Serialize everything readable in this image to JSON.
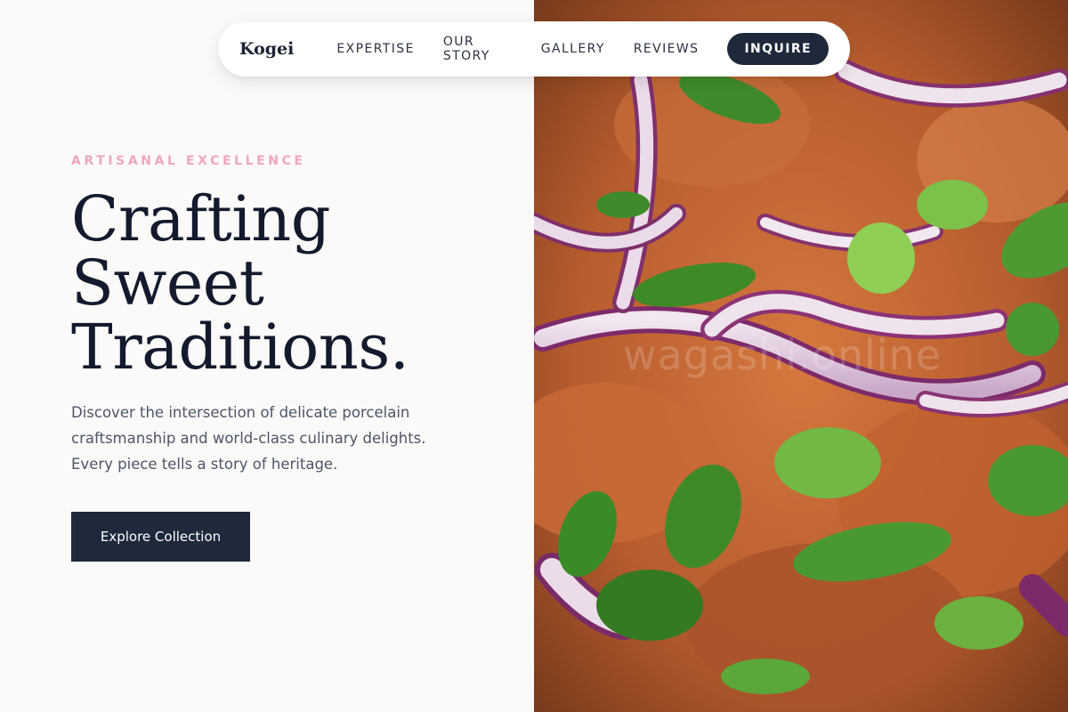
{
  "nav": {
    "brand": "Kogei",
    "links": [
      "EXPERTISE",
      "OUR STORY",
      "GALLERY",
      "REVIEWS"
    ],
    "cta_label": "INQUIRE"
  },
  "hero": {
    "eyebrow": "ARTISANAL EXCELLENCE",
    "headline": [
      "Crafting",
      "Sweet",
      "Traditions."
    ],
    "description": "Discover the intersection of delicate porcelain craftsmanship and world-class culinary delights. Every piece tells a story of heritage.",
    "cta_label": "Explore Collection"
  },
  "image": {
    "alt": "Close-up of a dish topped with sliced red onion and green onion",
    "watermark": "wagashi.online"
  },
  "colors": {
    "accent_dark": "#1e293b",
    "eyebrow_pink": "#f0a6bf",
    "background": "#fcfaf9"
  }
}
